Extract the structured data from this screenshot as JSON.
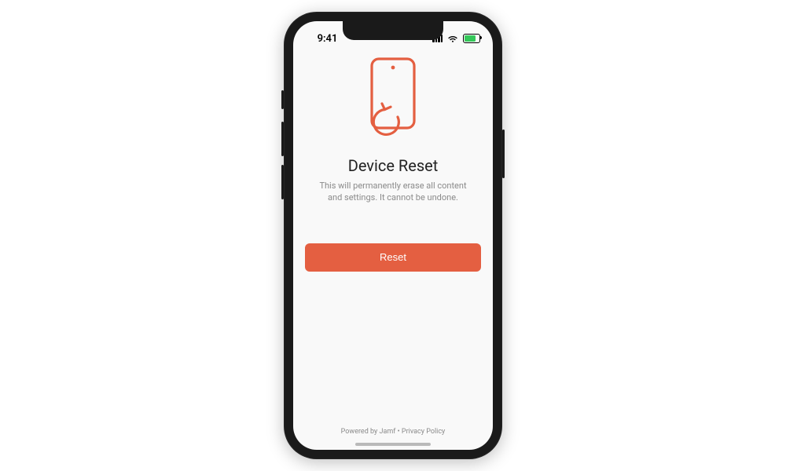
{
  "colors": {
    "accent": "#e45f41"
  },
  "statusbar": {
    "time": "9:41"
  },
  "content": {
    "title": "Device Reset",
    "subtitle": "This will permanently erase all content and settings. It cannot be undone.",
    "reset_label": "Reset"
  },
  "footer": {
    "powered_by": "Powered by Jamf",
    "sep": " • ",
    "privacy": "Privacy Policy"
  }
}
